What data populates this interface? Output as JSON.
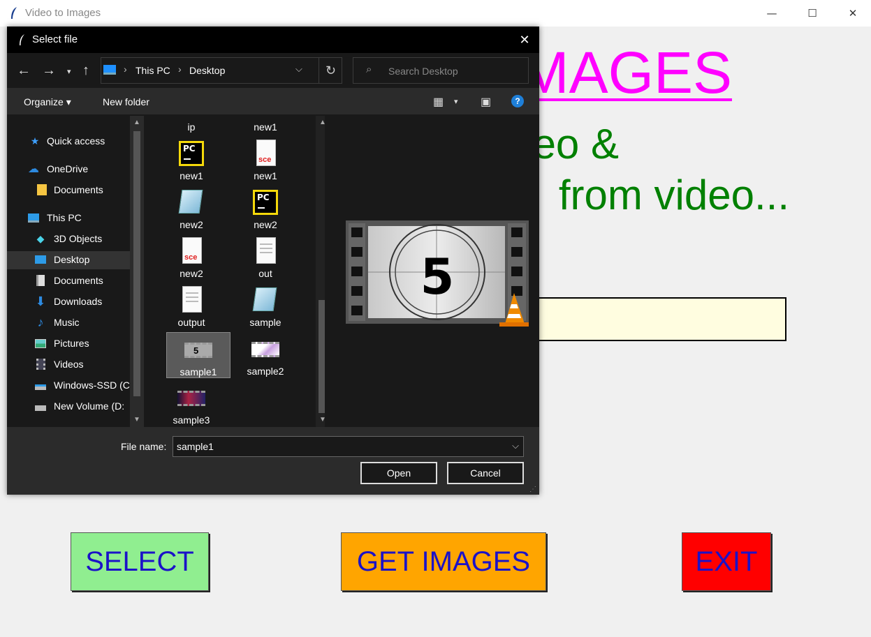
{
  "app": {
    "title": "Video to Images",
    "heading": "IMAGES",
    "subtitle_line1": "eo &",
    "subtitle_line2": "from video...",
    "buttons": {
      "select": "SELECT",
      "get_images": "GET IMAGES",
      "exit": "EXIT"
    },
    "window_controls": {
      "minimize": "—",
      "maximize": "☐",
      "close": "✕"
    }
  },
  "dialog": {
    "title": "Select file",
    "close_glyph": "✕",
    "address": {
      "crumbs": [
        "This PC",
        "Desktop"
      ],
      "sep": "›"
    },
    "search_placeholder": "Search Desktop",
    "toolbar": {
      "organize": "Organize ▾",
      "new_folder": "New folder",
      "help": "?"
    },
    "nav_items": [
      {
        "label": "Quick access",
        "icon": "star-icon"
      },
      {
        "label": "OneDrive",
        "icon": "cloud-icon"
      },
      {
        "label": "Documents",
        "icon": "folder-icon"
      },
      {
        "label": "This PC",
        "icon": "computer-icon"
      },
      {
        "label": "3D Objects",
        "icon": "cube-icon"
      },
      {
        "label": "Desktop",
        "icon": "desktop-icon"
      },
      {
        "label": "Documents",
        "icon": "documents-icon"
      },
      {
        "label": "Downloads",
        "icon": "download-icon"
      },
      {
        "label": "Music",
        "icon": "music-icon"
      },
      {
        "label": "Pictures",
        "icon": "pictures-icon"
      },
      {
        "label": "Videos",
        "icon": "videos-icon"
      },
      {
        "label": "Windows-SSD (C:",
        "icon": "drive-icon"
      },
      {
        "label": "New Volume (D:",
        "icon": "drive-icon"
      }
    ],
    "files": [
      {
        "name": "ip",
        "icon": "none"
      },
      {
        "name": "new1",
        "icon": "none"
      },
      {
        "name": "new1",
        "icon": "pycharm-icon"
      },
      {
        "name": "new1",
        "icon": "sce-icon"
      },
      {
        "name": "new2",
        "icon": "notepad-icon"
      },
      {
        "name": "new2",
        "icon": "pycharm-icon"
      },
      {
        "name": "new2",
        "icon": "sce-icon"
      },
      {
        "name": "out",
        "icon": "text-file-icon"
      },
      {
        "name": "output",
        "icon": "text-file-icon"
      },
      {
        "name": "sample",
        "icon": "notepad-icon"
      },
      {
        "name": "sample1",
        "icon": "video-thumb-icon"
      },
      {
        "name": "sample2",
        "icon": "video-thumb-icon"
      },
      {
        "name": "sample3",
        "icon": "video-thumb-icon"
      }
    ],
    "selected_file": "sample1",
    "preview_number": "5",
    "file_name_label": "File name:",
    "file_name_value": "sample1",
    "open_label": "Open",
    "cancel_label": "Cancel"
  },
  "colors": {
    "heading": "#ff00ff",
    "subtitle": "#008000",
    "select_bg": "#90ee90",
    "get_bg": "#ffa500",
    "exit_bg": "#ff0000",
    "button_text": "#1b12c8",
    "entry_bg": "#fffde0"
  }
}
